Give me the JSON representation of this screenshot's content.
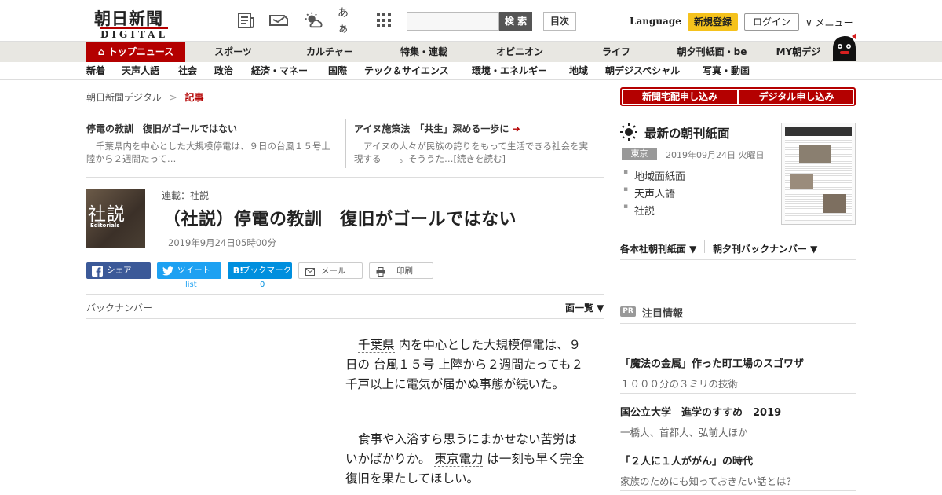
{
  "header": {
    "logo_main": "朝日新聞",
    "logo_sub": "DIGITAL",
    "icons": [
      "newspaper-icon",
      "coupon-icon",
      "weather-icon",
      "font-size-icon",
      "apps-grid-icon"
    ],
    "font_icon_text": "あぁ",
    "search_placeholder": "",
    "search_label": "検 索",
    "toc_label": "目次",
    "language": "Language",
    "register": "新規登録",
    "login": "ログイン",
    "menu": "∨ メニュー"
  },
  "nav_primary": [
    {
      "label": "トップニュース"
    },
    {
      "label": "スポーツ"
    },
    {
      "label": "カルチャー"
    },
    {
      "label": "特集・連載"
    },
    {
      "label": "オピニオン"
    },
    {
      "label": "ライフ"
    },
    {
      "label": "朝夕刊紙面・be"
    },
    {
      "label": "MY朝デジ"
    }
  ],
  "nav_secondary": [
    {
      "label": "新着"
    },
    {
      "label": "天声人語"
    },
    {
      "label": "社会"
    },
    {
      "label": "政治"
    },
    {
      "label": "経済・マネー"
    },
    {
      "label": "国際"
    },
    {
      "label": "テック＆サイエンス"
    },
    {
      "label": "環境・エネルギー"
    },
    {
      "label": "地域"
    },
    {
      "label": "朝デジスペシャル"
    },
    {
      "label": "写真・動画"
    }
  ],
  "breadcrumb": {
    "home": "朝日新聞デジタル",
    "sep": ">",
    "current": "記事"
  },
  "related": [
    {
      "title": "停電の教訓　復旧がゴールではない",
      "desc": "千葉県内を中心とした大規模停電は、９日の台風１５号上陸から２週間たって…"
    },
    {
      "title": "アイヌ施策法　「共生」深める一歩に",
      "desc": "アイヌの人々が民族の誇りをもって生活できる社会を実現する――。そううた…[続きを読む]"
    }
  ],
  "article": {
    "thumb_kanji": "社説",
    "thumb_en": "Editorials",
    "series": "連載：社説",
    "headline": "（社説）停電の教訓　復旧がゴールではない",
    "date": "2019年9月24日05時00分",
    "paragraphs": [
      {
        "parts": [
          "",
          "千葉県",
          " 内を中心とした大規模停電は、９日の ",
          "台風１５号",
          " 上陸から２週間たっても２千戸以上に電気が届かぬ事態が続いた。"
        ]
      },
      {
        "parts": [
          "食事や入浴すら思うにまかせない苦労はいかばかりか。 ",
          "東京電力",
          " は一刻も早く完全復旧を果たしてほしい。"
        ]
      }
    ]
  },
  "share": {
    "facebook": "シェア",
    "twitter": "ツイート",
    "hatena": "ブックマーク",
    "hatena_icon": "B!",
    "mail": "メール",
    "print": "印刷",
    "twitter_count": "list",
    "hatena_count": "0"
  },
  "backnumber": "バックナンバー",
  "page_list": "面一覧 ▼",
  "sidebar": {
    "sub_home": "新聞宅配申し込み",
    "sub_digital": "デジタル申し込み",
    "latest_title": "最新の朝刊紙面",
    "edition": "東京",
    "edition_date": "2019年09月24日 火曜日",
    "links": [
      "地域面紙面",
      "天声人語",
      "社説"
    ],
    "select1": "各本社朝刊紙面 ▼",
    "select2": "朝夕刊バックナンバー ▼",
    "pr_badge": "PR",
    "pr_title": "注目情報",
    "pr_items": [
      {
        "title": "「魔法の金属」作った町工場のスゴワザ",
        "desc": "１０００分の３ミリの技術"
      },
      {
        "title": "国公立大学　進学のすすめ　2019",
        "desc": "一橋大、首都大、弘前大ほか"
      },
      {
        "title": "「２人に１人ががん」の時代",
        "desc": "家族のためにも知っておきたい話とは？"
      }
    ]
  },
  "colors": {
    "brand_red": "#b40000",
    "register_yellow": "#f5c21c",
    "facebook": "#3b5998",
    "twitter": "#1da1f2",
    "hatena": "#008fde"
  }
}
